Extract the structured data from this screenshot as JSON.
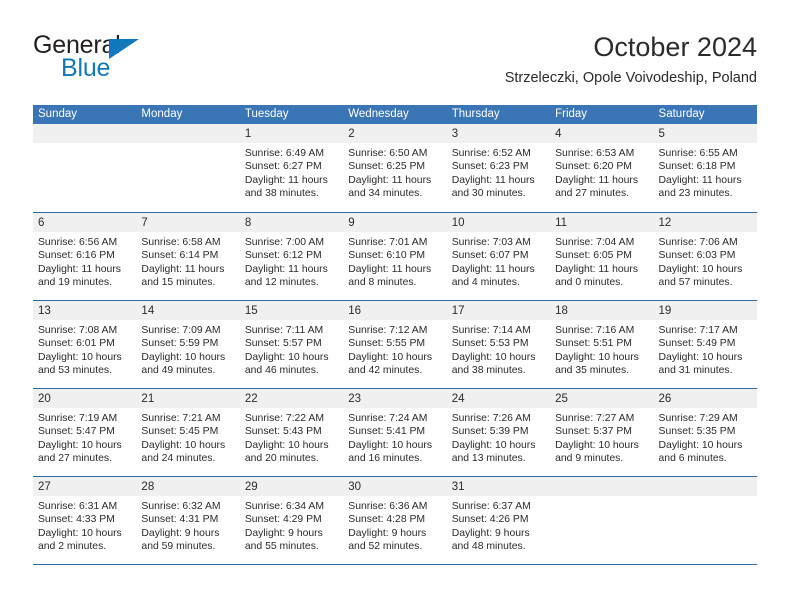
{
  "brand": {
    "word_one": "General",
    "word_two": "Blue",
    "triangle_icon": "triangle-icon",
    "accent_color": "#1278be"
  },
  "header": {
    "title": "October 2024",
    "subtitle": "Strzeleczki, Opole Voivodeship, Poland"
  },
  "theme": {
    "header_blue": "#3a75b5",
    "rule_blue": "#2f6aad",
    "day_head_gray": "#f0f0f0"
  },
  "calendar": {
    "weekdays": [
      "Sunday",
      "Monday",
      "Tuesday",
      "Wednesday",
      "Thursday",
      "Friday",
      "Saturday"
    ],
    "weeks": [
      [
        {
          "day": "",
          "empty": true
        },
        {
          "day": "",
          "empty": true
        },
        {
          "day": "1",
          "sunrise": "Sunrise: 6:49 AM",
          "sunset": "Sunset: 6:27 PM",
          "daylight1": "Daylight: 11 hours",
          "daylight2": "and 38 minutes."
        },
        {
          "day": "2",
          "sunrise": "Sunrise: 6:50 AM",
          "sunset": "Sunset: 6:25 PM",
          "daylight1": "Daylight: 11 hours",
          "daylight2": "and 34 minutes."
        },
        {
          "day": "3",
          "sunrise": "Sunrise: 6:52 AM",
          "sunset": "Sunset: 6:23 PM",
          "daylight1": "Daylight: 11 hours",
          "daylight2": "and 30 minutes."
        },
        {
          "day": "4",
          "sunrise": "Sunrise: 6:53 AM",
          "sunset": "Sunset: 6:20 PM",
          "daylight1": "Daylight: 11 hours",
          "daylight2": "and 27 minutes."
        },
        {
          "day": "5",
          "sunrise": "Sunrise: 6:55 AM",
          "sunset": "Sunset: 6:18 PM",
          "daylight1": "Daylight: 11 hours",
          "daylight2": "and 23 minutes."
        }
      ],
      [
        {
          "day": "6",
          "sunrise": "Sunrise: 6:56 AM",
          "sunset": "Sunset: 6:16 PM",
          "daylight1": "Daylight: 11 hours",
          "daylight2": "and 19 minutes."
        },
        {
          "day": "7",
          "sunrise": "Sunrise: 6:58 AM",
          "sunset": "Sunset: 6:14 PM",
          "daylight1": "Daylight: 11 hours",
          "daylight2": "and 15 minutes."
        },
        {
          "day": "8",
          "sunrise": "Sunrise: 7:00 AM",
          "sunset": "Sunset: 6:12 PM",
          "daylight1": "Daylight: 11 hours",
          "daylight2": "and 12 minutes."
        },
        {
          "day": "9",
          "sunrise": "Sunrise: 7:01 AM",
          "sunset": "Sunset: 6:10 PM",
          "daylight1": "Daylight: 11 hours",
          "daylight2": "and 8 minutes."
        },
        {
          "day": "10",
          "sunrise": "Sunrise: 7:03 AM",
          "sunset": "Sunset: 6:07 PM",
          "daylight1": "Daylight: 11 hours",
          "daylight2": "and 4 minutes."
        },
        {
          "day": "11",
          "sunrise": "Sunrise: 7:04 AM",
          "sunset": "Sunset: 6:05 PM",
          "daylight1": "Daylight: 11 hours",
          "daylight2": "and 0 minutes."
        },
        {
          "day": "12",
          "sunrise": "Sunrise: 7:06 AM",
          "sunset": "Sunset: 6:03 PM",
          "daylight1": "Daylight: 10 hours",
          "daylight2": "and 57 minutes."
        }
      ],
      [
        {
          "day": "13",
          "sunrise": "Sunrise: 7:08 AM",
          "sunset": "Sunset: 6:01 PM",
          "daylight1": "Daylight: 10 hours",
          "daylight2": "and 53 minutes."
        },
        {
          "day": "14",
          "sunrise": "Sunrise: 7:09 AM",
          "sunset": "Sunset: 5:59 PM",
          "daylight1": "Daylight: 10 hours",
          "daylight2": "and 49 minutes."
        },
        {
          "day": "15",
          "sunrise": "Sunrise: 7:11 AM",
          "sunset": "Sunset: 5:57 PM",
          "daylight1": "Daylight: 10 hours",
          "daylight2": "and 46 minutes."
        },
        {
          "day": "16",
          "sunrise": "Sunrise: 7:12 AM",
          "sunset": "Sunset: 5:55 PM",
          "daylight1": "Daylight: 10 hours",
          "daylight2": "and 42 minutes."
        },
        {
          "day": "17",
          "sunrise": "Sunrise: 7:14 AM",
          "sunset": "Sunset: 5:53 PM",
          "daylight1": "Daylight: 10 hours",
          "daylight2": "and 38 minutes."
        },
        {
          "day": "18",
          "sunrise": "Sunrise: 7:16 AM",
          "sunset": "Sunset: 5:51 PM",
          "daylight1": "Daylight: 10 hours",
          "daylight2": "and 35 minutes."
        },
        {
          "day": "19",
          "sunrise": "Sunrise: 7:17 AM",
          "sunset": "Sunset: 5:49 PM",
          "daylight1": "Daylight: 10 hours",
          "daylight2": "and 31 minutes."
        }
      ],
      [
        {
          "day": "20",
          "sunrise": "Sunrise: 7:19 AM",
          "sunset": "Sunset: 5:47 PM",
          "daylight1": "Daylight: 10 hours",
          "daylight2": "and 27 minutes."
        },
        {
          "day": "21",
          "sunrise": "Sunrise: 7:21 AM",
          "sunset": "Sunset: 5:45 PM",
          "daylight1": "Daylight: 10 hours",
          "daylight2": "and 24 minutes."
        },
        {
          "day": "22",
          "sunrise": "Sunrise: 7:22 AM",
          "sunset": "Sunset: 5:43 PM",
          "daylight1": "Daylight: 10 hours",
          "daylight2": "and 20 minutes."
        },
        {
          "day": "23",
          "sunrise": "Sunrise: 7:24 AM",
          "sunset": "Sunset: 5:41 PM",
          "daylight1": "Daylight: 10 hours",
          "daylight2": "and 16 minutes."
        },
        {
          "day": "24",
          "sunrise": "Sunrise: 7:26 AM",
          "sunset": "Sunset: 5:39 PM",
          "daylight1": "Daylight: 10 hours",
          "daylight2": "and 13 minutes."
        },
        {
          "day": "25",
          "sunrise": "Sunrise: 7:27 AM",
          "sunset": "Sunset: 5:37 PM",
          "daylight1": "Daylight: 10 hours",
          "daylight2": "and 9 minutes."
        },
        {
          "day": "26",
          "sunrise": "Sunrise: 7:29 AM",
          "sunset": "Sunset: 5:35 PM",
          "daylight1": "Daylight: 10 hours",
          "daylight2": "and 6 minutes."
        }
      ],
      [
        {
          "day": "27",
          "sunrise": "Sunrise: 6:31 AM",
          "sunset": "Sunset: 4:33 PM",
          "daylight1": "Daylight: 10 hours",
          "daylight2": "and 2 minutes."
        },
        {
          "day": "28",
          "sunrise": "Sunrise: 6:32 AM",
          "sunset": "Sunset: 4:31 PM",
          "daylight1": "Daylight: 9 hours",
          "daylight2": "and 59 minutes."
        },
        {
          "day": "29",
          "sunrise": "Sunrise: 6:34 AM",
          "sunset": "Sunset: 4:29 PM",
          "daylight1": "Daylight: 9 hours",
          "daylight2": "and 55 minutes."
        },
        {
          "day": "30",
          "sunrise": "Sunrise: 6:36 AM",
          "sunset": "Sunset: 4:28 PM",
          "daylight1": "Daylight: 9 hours",
          "daylight2": "and 52 minutes."
        },
        {
          "day": "31",
          "sunrise": "Sunrise: 6:37 AM",
          "sunset": "Sunset: 4:26 PM",
          "daylight1": "Daylight: 9 hours",
          "daylight2": "and 48 minutes."
        },
        {
          "day": "",
          "empty": true
        },
        {
          "day": "",
          "empty": true
        }
      ]
    ]
  }
}
